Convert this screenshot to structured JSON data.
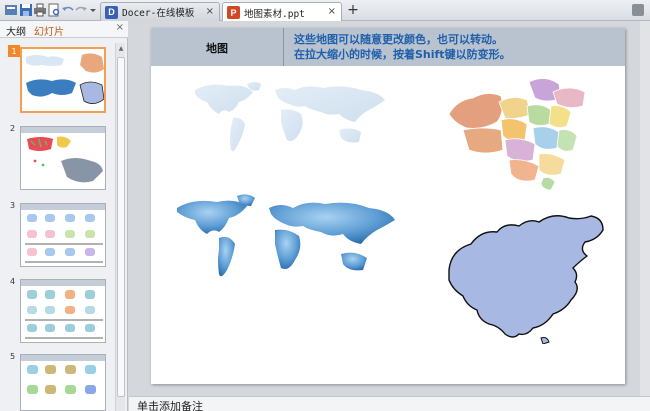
{
  "titlebar": {
    "tabs": [
      {
        "label": "Docer-在线模板",
        "badge": "D",
        "badge_color": "#3b5fb5"
      },
      {
        "label": "地图素材.ppt",
        "badge": "P",
        "badge_color": "#d24726"
      }
    ],
    "new_tab": "+",
    "close_glyph": "×"
  },
  "panel": {
    "tabs": [
      "大纲",
      "幻灯片"
    ],
    "close_glyph": "×",
    "slide_numbers": [
      "1",
      "2",
      "3",
      "4",
      "5"
    ]
  },
  "slide": {
    "header_title": "地图",
    "header_desc_line1": "这些地图可以随意更改颜色，也可以转动。",
    "header_desc_line2": "在拉大缩小的时候，按着Shift键以防变形。"
  },
  "notes": {
    "placeholder": "单击添加备注"
  },
  "colors": {
    "accent": "#f0882a",
    "header_bg": "#b8c3cf",
    "desc_text": "#1f5faa",
    "world_light": "#d9e7f4",
    "world_blue": "#3b7ec0",
    "china_blue": "#a7b9e3"
  }
}
